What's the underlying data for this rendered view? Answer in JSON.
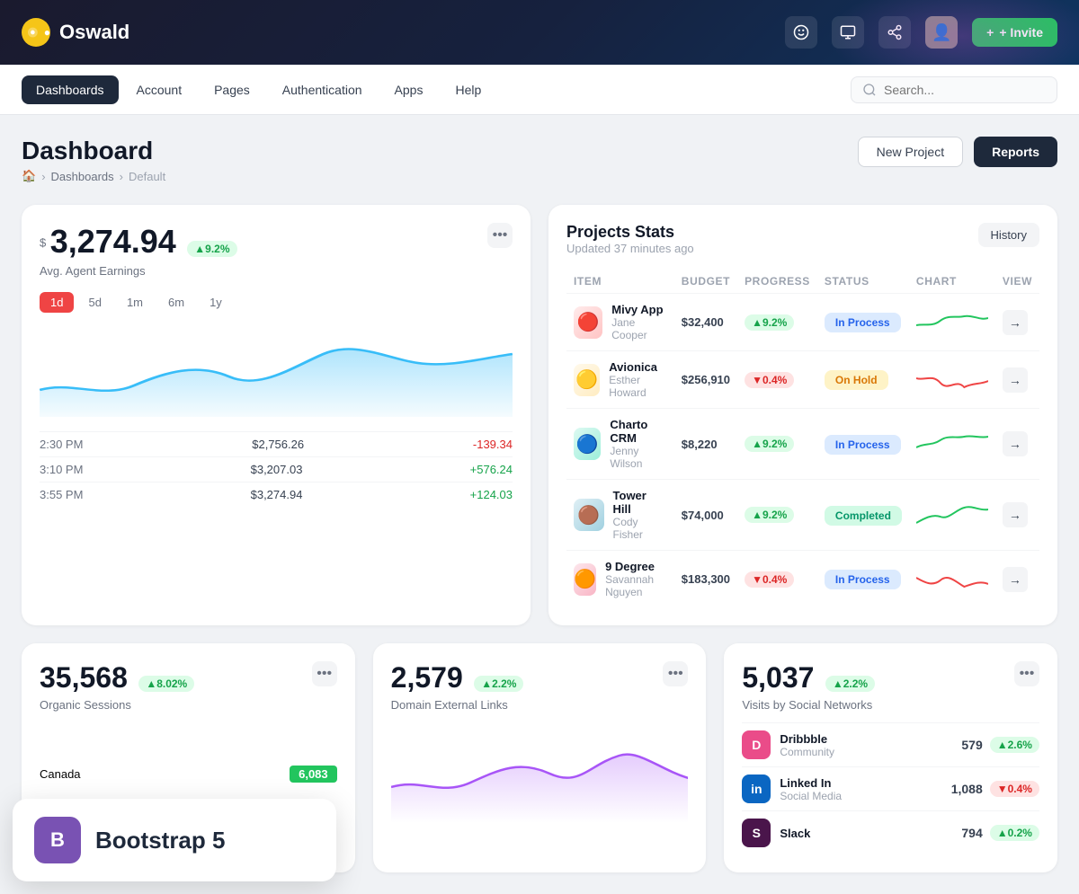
{
  "brand": {
    "name": "Oswald"
  },
  "topnav": {
    "icons": [
      "🎭",
      "📊",
      "🔗"
    ],
    "invite_label": "+ Invite"
  },
  "secondarynav": {
    "tabs": [
      {
        "label": "Dashboards",
        "active": true
      },
      {
        "label": "Account",
        "active": false
      },
      {
        "label": "Pages",
        "active": false
      },
      {
        "label": "Authentication",
        "active": false
      },
      {
        "label": "Apps",
        "active": false
      },
      {
        "label": "Help",
        "active": false
      }
    ],
    "search_placeholder": "Search..."
  },
  "page_header": {
    "title": "Dashboard",
    "breadcrumb": [
      "🏠",
      "Dashboards",
      "Default"
    ],
    "btn_new_project": "New Project",
    "btn_reports": "Reports"
  },
  "earnings_card": {
    "currency": "$",
    "value": "3,274.94",
    "badge": "▲9.2%",
    "label": "Avg. Agent Earnings",
    "time_filters": [
      "1d",
      "5d",
      "1m",
      "6m",
      "1y"
    ],
    "active_filter": "1d",
    "entries": [
      {
        "time": "2:30 PM",
        "amount": "$2,756.26",
        "change": "-139.34",
        "positive": false
      },
      {
        "time": "3:10 PM",
        "amount": "$3,207.03",
        "change": "+576.24",
        "positive": true
      },
      {
        "time": "3:55 PM",
        "amount": "$3,274.94",
        "change": "+124.03",
        "positive": true
      }
    ]
  },
  "projects_card": {
    "title": "Projects Stats",
    "subtitle": "Updated 37 minutes ago",
    "history_btn": "History",
    "columns": [
      "ITEM",
      "BUDGET",
      "PROGRESS",
      "STATUS",
      "CHART",
      "VIEW"
    ],
    "rows": [
      {
        "name": "Mivy App",
        "author": "Jane Cooper",
        "budget": "$32,400",
        "progress": "▲9.2%",
        "progress_pos": true,
        "status": "In Process",
        "status_type": "inprocess",
        "emoji": "🔴"
      },
      {
        "name": "Avionica",
        "author": "Esther Howard",
        "budget": "$256,910",
        "progress": "▼0.4%",
        "progress_pos": false,
        "status": "On Hold",
        "status_type": "onhold",
        "emoji": "🟡"
      },
      {
        "name": "Charto CRM",
        "author": "Jenny Wilson",
        "budget": "$8,220",
        "progress": "▲9.2%",
        "progress_pos": true,
        "status": "In Process",
        "status_type": "inprocess",
        "emoji": "🔵"
      },
      {
        "name": "Tower Hill",
        "author": "Cody Fisher",
        "budget": "$74,000",
        "progress": "▲9.2%",
        "progress_pos": true,
        "status": "Completed",
        "status_type": "completed",
        "emoji": "🟤"
      },
      {
        "name": "9 Degree",
        "author": "Savannah Nguyen",
        "budget": "$183,300",
        "progress": "▼0.4%",
        "progress_pos": false,
        "status": "In Process",
        "status_type": "inprocess",
        "emoji": "🟠"
      }
    ]
  },
  "organic_card": {
    "value": "35,568",
    "badge": "▲8.02%",
    "label": "Organic Sessions",
    "map_rows": [
      {
        "country": "Canada",
        "value": "6,083",
        "pct": 65
      }
    ]
  },
  "domain_card": {
    "value": "2,579",
    "badge": "▲2.2%",
    "label": "Domain External Links"
  },
  "social_card": {
    "value": "5,037",
    "badge": "▲2.2%",
    "label": "Visits by Social Networks",
    "items": [
      {
        "name": "Dribbble",
        "type": "Community",
        "count": "579",
        "badge": "▲2.6%",
        "badge_pos": true,
        "color": "#ea4c89"
      },
      {
        "name": "Linked In",
        "type": "Social Media",
        "count": "1,088",
        "badge": "▼0.4%",
        "badge_pos": false,
        "color": "#0a66c2"
      },
      {
        "name": "Slack",
        "type": "",
        "count": "794",
        "badge": "▲0.2%",
        "badge_pos": true,
        "color": "#4a154b"
      }
    ]
  },
  "bootstrap": {
    "logo_letter": "B",
    "label": "Bootstrap 5"
  }
}
